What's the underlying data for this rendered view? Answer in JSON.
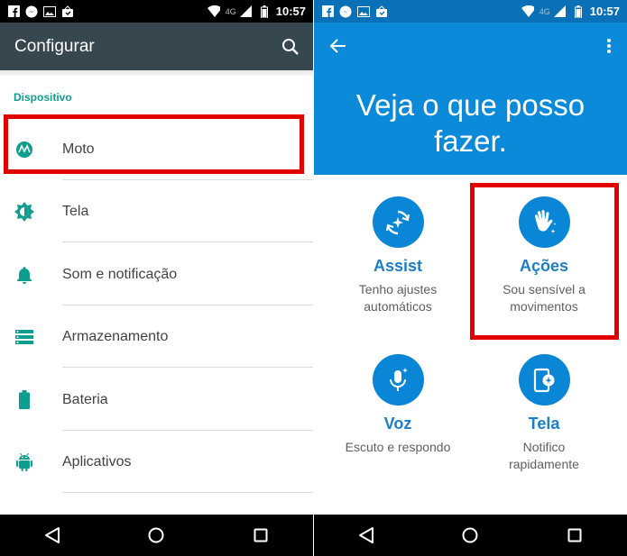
{
  "left": {
    "status": {
      "time": "10:57",
      "network": "4G"
    },
    "toolbar": {
      "title": "Configurar"
    },
    "section": "Dispositivo",
    "items": [
      {
        "label": "Moto",
        "icon": "moto-icon"
      },
      {
        "label": "Tela",
        "icon": "brightness-icon"
      },
      {
        "label": "Som e notificação",
        "icon": "bell-icon"
      },
      {
        "label": "Armazenamento",
        "icon": "storage-icon"
      },
      {
        "label": "Bateria",
        "icon": "battery-icon"
      },
      {
        "label": "Aplicativos",
        "icon": "android-icon"
      }
    ]
  },
  "right": {
    "status": {
      "time": "10:57",
      "network": "4G"
    },
    "headline_line1": "Veja o que posso",
    "headline_line2": "fazer.",
    "features": [
      {
        "name": "Assist",
        "desc1": "Tenho ajustes",
        "desc2": "automáticos",
        "icon": "assist-icon"
      },
      {
        "name": "Ações",
        "desc1": "Sou sensível a",
        "desc2": "movimentos",
        "icon": "wave-hand-icon"
      },
      {
        "name": "Voz",
        "desc1": "Escuto e respondo",
        "desc2": "",
        "icon": "microphone-icon"
      },
      {
        "name": "Tela",
        "desc1": "Notifico",
        "desc2": "rapidamente",
        "icon": "phone-screen-icon"
      }
    ]
  },
  "colors": {
    "accent_teal": "#0f9d8f",
    "toolbar_dark": "#37474f",
    "moto_blue": "#0a8ad8",
    "highlight_red": "#e00000"
  }
}
